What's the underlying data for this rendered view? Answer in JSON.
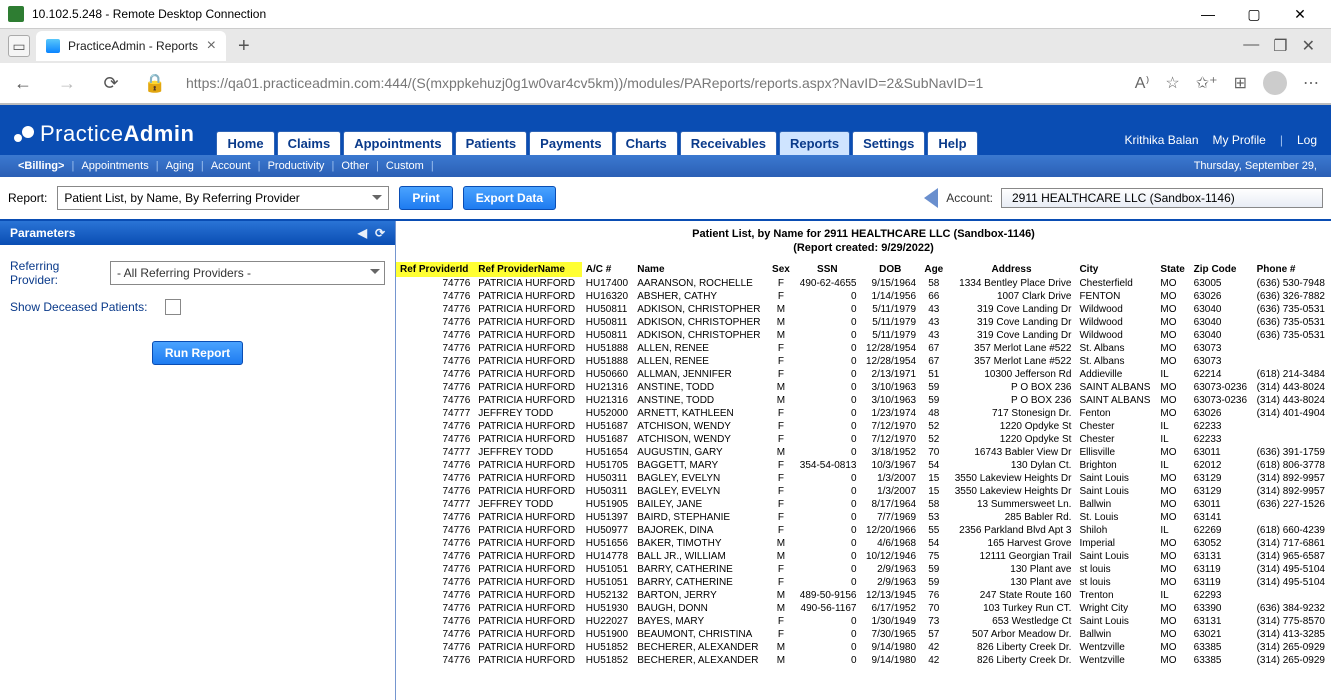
{
  "window": {
    "title": "10.102.5.248 - Remote Desktop Connection"
  },
  "browser": {
    "tab_title": "PracticeAdmin - Reports",
    "url": "https://qa01.practiceadmin.com:444/(S(mxppkehuzj0g1w0var4cv5km))/modules/PAReports/reports.aspx?NavID=2&SubNavID=1"
  },
  "logo": {
    "text1": "Practice",
    "text2": "Admin"
  },
  "main_nav": [
    "Home",
    "Claims",
    "Appointments",
    "Patients",
    "Payments",
    "Charts",
    "Receivables",
    "Reports",
    "Settings",
    "Help"
  ],
  "main_nav_active": 7,
  "header_user": {
    "name": "Krithika Balan",
    "profile": "My Profile",
    "logout": "Log"
  },
  "sub_nav": [
    "<Billing>",
    "Appointments",
    "Aging",
    "Account",
    "Productivity",
    "Other",
    "Custom"
  ],
  "date_text": "Thursday, September 29,",
  "toolbar": {
    "report_label": "Report:",
    "report_value": "Patient List, by Name, By Referring Provider",
    "print": "Print",
    "export": "Export Data",
    "account_label": "Account:",
    "account_value": "2911 HEALTHCARE LLC (Sandbox-1146)"
  },
  "parameters": {
    "title": "Parameters",
    "ref_label": "Referring Provider:",
    "ref_value": "- All Referring Providers -",
    "deceased_label": "Show Deceased Patients:",
    "run_label": "Run Report"
  },
  "report": {
    "title1": "Patient List, by Name for 2911 HEALTHCARE LLC (Sandbox-1146)",
    "title2": "(Report created: 9/29/2022)",
    "columns": [
      "Ref ProviderId",
      "Ref ProviderName",
      "A/C #",
      "Name",
      "Sex",
      "SSN",
      "DOB",
      "Age",
      "Address",
      "City",
      "State",
      "Zip Code",
      "Phone #"
    ],
    "rows": [
      [
        "74776",
        "PATRICIA HURFORD",
        "HU17400",
        "AARANSON, ROCHELLE",
        "F",
        "490-62-4655",
        "9/15/1964",
        "58",
        "1334 Bentley Place Drive",
        "Chesterfield",
        "MO",
        "63005",
        "(636) 530-7948"
      ],
      [
        "74776",
        "PATRICIA HURFORD",
        "HU16320",
        "ABSHER, CATHY",
        "F",
        "0",
        "1/14/1956",
        "66",
        "1007 Clark Drive",
        "FENTON",
        "MO",
        "63026",
        "(636) 326-7882"
      ],
      [
        "74776",
        "PATRICIA HURFORD",
        "HU50811",
        "ADKISON, CHRISTOPHER",
        "M",
        "0",
        "5/11/1979",
        "43",
        "319 Cove Landing Dr",
        "Wildwood",
        "MO",
        "63040",
        "(636) 735-0531"
      ],
      [
        "74776",
        "PATRICIA HURFORD",
        "HU50811",
        "ADKISON, CHRISTOPHER",
        "M",
        "0",
        "5/11/1979",
        "43",
        "319 Cove Landing Dr",
        "Wildwood",
        "MO",
        "63040",
        "(636) 735-0531"
      ],
      [
        "74776",
        "PATRICIA HURFORD",
        "HU50811",
        "ADKISON, CHRISTOPHER",
        "M",
        "0",
        "5/11/1979",
        "43",
        "319 Cove Landing Dr",
        "Wildwood",
        "MO",
        "63040",
        "(636) 735-0531"
      ],
      [
        "74776",
        "PATRICIA HURFORD",
        "HU51888",
        "ALLEN, RENEE",
        "F",
        "0",
        "12/28/1954",
        "67",
        "357 Merlot Lane #522",
        "St. Albans",
        "MO",
        "63073",
        ""
      ],
      [
        "74776",
        "PATRICIA HURFORD",
        "HU51888",
        "ALLEN, RENEE",
        "F",
        "0",
        "12/28/1954",
        "67",
        "357 Merlot Lane #522",
        "St. Albans",
        "MO",
        "63073",
        ""
      ],
      [
        "74776",
        "PATRICIA HURFORD",
        "HU50660",
        "ALLMAN, JENNIFER",
        "F",
        "0",
        "2/13/1971",
        "51",
        "10300 Jefferson Rd",
        "Addieville",
        "IL",
        "62214",
        "(618) 214-3484"
      ],
      [
        "74776",
        "PATRICIA HURFORD",
        "HU21316",
        "ANSTINE, TODD",
        "M",
        "0",
        "3/10/1963",
        "59",
        "P O BOX 236",
        "SAINT ALBANS",
        "MO",
        "63073-0236",
        "(314) 443-8024"
      ],
      [
        "74776",
        "PATRICIA HURFORD",
        "HU21316",
        "ANSTINE, TODD",
        "M",
        "0",
        "3/10/1963",
        "59",
        "P O BOX 236",
        "SAINT ALBANS",
        "MO",
        "63073-0236",
        "(314) 443-8024"
      ],
      [
        "74777",
        "JEFFREY TODD",
        "HU52000",
        "ARNETT, KATHLEEN",
        "F",
        "0",
        "1/23/1974",
        "48",
        "717 Stonesign Dr.",
        "Fenton",
        "MO",
        "63026",
        "(314) 401-4904"
      ],
      [
        "74776",
        "PATRICIA HURFORD",
        "HU51687",
        "ATCHISON, WENDY",
        "F",
        "0",
        "7/12/1970",
        "52",
        "1220 Opdyke St",
        "Chester",
        "IL",
        "62233",
        ""
      ],
      [
        "74776",
        "PATRICIA HURFORD",
        "HU51687",
        "ATCHISON, WENDY",
        "F",
        "0",
        "7/12/1970",
        "52",
        "1220 Opdyke St",
        "Chester",
        "IL",
        "62233",
        ""
      ],
      [
        "74777",
        "JEFFREY TODD",
        "HU51654",
        "AUGUSTIN, GARY",
        "M",
        "0",
        "3/18/1952",
        "70",
        "16743 Babler View Dr",
        "Ellisville",
        "MO",
        "63011",
        "(636) 391-1759"
      ],
      [
        "74776",
        "PATRICIA HURFORD",
        "HU51705",
        "BAGGETT, MARY",
        "F",
        "354-54-0813",
        "10/3/1967",
        "54",
        "130 Dylan Ct.",
        "Brighton",
        "IL",
        "62012",
        "(618) 806-3778"
      ],
      [
        "74776",
        "PATRICIA HURFORD",
        "HU50311",
        "BAGLEY, EVELYN",
        "F",
        "0",
        "1/3/2007",
        "15",
        "3550 Lakeview Heights Dr",
        "Saint Louis",
        "MO",
        "63129",
        "(314) 892-9957"
      ],
      [
        "74776",
        "PATRICIA HURFORD",
        "HU50311",
        "BAGLEY, EVELYN",
        "F",
        "0",
        "1/3/2007",
        "15",
        "3550 Lakeview Heights Dr",
        "Saint Louis",
        "MO",
        "63129",
        "(314) 892-9957"
      ],
      [
        "74777",
        "JEFFREY TODD",
        "HU51905",
        "BAILEY, JANE",
        "F",
        "0",
        "8/17/1964",
        "58",
        "13 Summersweet Ln.",
        "Ballwin",
        "MO",
        "63011",
        "(636) 227-1526"
      ],
      [
        "74776",
        "PATRICIA HURFORD",
        "HU51397",
        "BAIRD, STEPHANIE",
        "F",
        "0",
        "7/7/1969",
        "53",
        "285 Babler Rd.",
        "St. Louis",
        "MO",
        "63141",
        ""
      ],
      [
        "74776",
        "PATRICIA HURFORD",
        "HU50977",
        "BAJOREK, DINA",
        "F",
        "0",
        "12/20/1966",
        "55",
        "2356 Parkland Blvd Apt 3",
        "Shiloh",
        "IL",
        "62269",
        "(618) 660-4239"
      ],
      [
        "74776",
        "PATRICIA HURFORD",
        "HU51656",
        "BAKER, TIMOTHY",
        "M",
        "0",
        "4/6/1968",
        "54",
        "165 Harvest Grove",
        "Imperial",
        "MO",
        "63052",
        "(314) 717-6861"
      ],
      [
        "74776",
        "PATRICIA HURFORD",
        "HU14778",
        "BALL JR., WILLIAM",
        "M",
        "0",
        "10/12/1946",
        "75",
        "12111 Georgian Trail",
        "Saint Louis",
        "MO",
        "63131",
        "(314) 965-6587"
      ],
      [
        "74776",
        "PATRICIA HURFORD",
        "HU51051",
        "BARRY, CATHERINE",
        "F",
        "0",
        "2/9/1963",
        "59",
        "130 Plant ave",
        "st louis",
        "MO",
        "63119",
        "(314) 495-5104"
      ],
      [
        "74776",
        "PATRICIA HURFORD",
        "HU51051",
        "BARRY, CATHERINE",
        "F",
        "0",
        "2/9/1963",
        "59",
        "130 Plant ave",
        "st louis",
        "MO",
        "63119",
        "(314) 495-5104"
      ],
      [
        "74776",
        "PATRICIA HURFORD",
        "HU52132",
        "BARTON, JERRY",
        "M",
        "489-50-9156",
        "12/13/1945",
        "76",
        "247 State Route 160",
        "Trenton",
        "IL",
        "62293",
        ""
      ],
      [
        "74776",
        "PATRICIA HURFORD",
        "HU51930",
        "BAUGH, DONN",
        "M",
        "490-56-1167",
        "6/17/1952",
        "70",
        "103 Turkey Run CT.",
        "Wright City",
        "MO",
        "63390",
        "(636) 384-9232"
      ],
      [
        "74776",
        "PATRICIA HURFORD",
        "HU22027",
        "BAYES, MARY",
        "F",
        "0",
        "1/30/1949",
        "73",
        "653 Westledge Ct",
        "Saint Louis",
        "MO",
        "63131",
        "(314) 775-8570"
      ],
      [
        "74776",
        "PATRICIA HURFORD",
        "HU51900",
        "BEAUMONT, CHRISTINA",
        "F",
        "0",
        "7/30/1965",
        "57",
        "507 Arbor Meadow Dr.",
        "Ballwin",
        "MO",
        "63021",
        "(314) 413-3285"
      ],
      [
        "74776",
        "PATRICIA HURFORD",
        "HU51852",
        "BECHERER, ALEXANDER",
        "M",
        "0",
        "9/14/1980",
        "42",
        "826 Liberty Creek Dr.",
        "Wentzville",
        "MO",
        "63385",
        "(314) 265-0929"
      ],
      [
        "74776",
        "PATRICIA HURFORD",
        "HU51852",
        "BECHERER, ALEXANDER",
        "M",
        "0",
        "9/14/1980",
        "42",
        "826 Liberty Creek Dr.",
        "Wentzville",
        "MO",
        "63385",
        "(314) 265-0929"
      ]
    ]
  }
}
